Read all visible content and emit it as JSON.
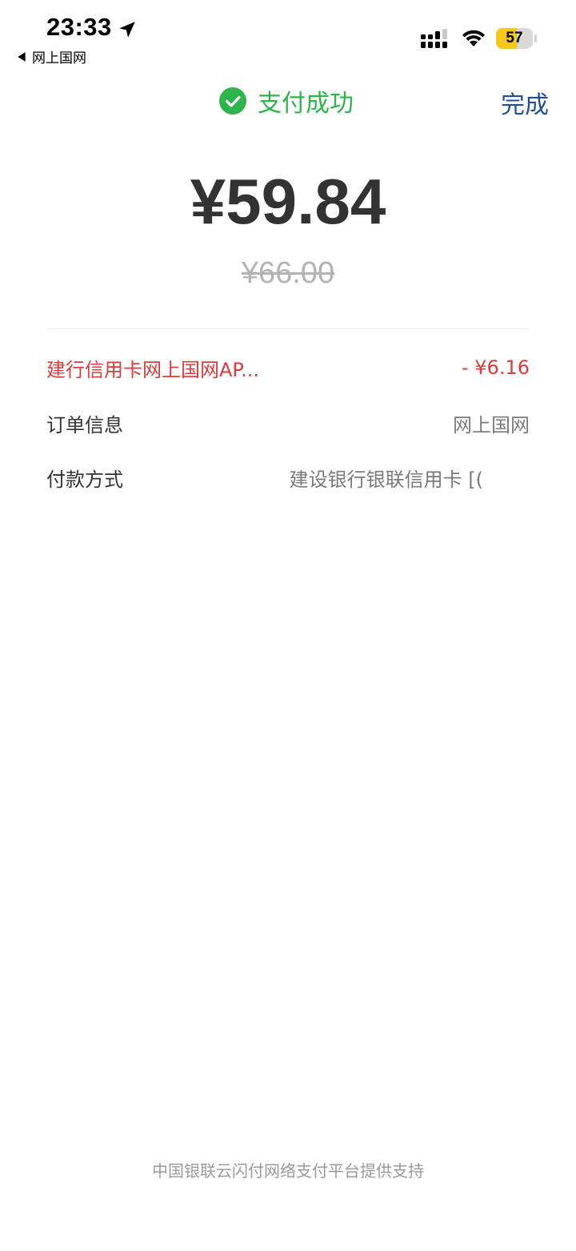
{
  "status_bar": {
    "time": "23:33",
    "back_app_label": "网上国网",
    "battery_level": "57",
    "battery_percent": 57,
    "icons": [
      "location-arrow-icon",
      "cellular-signal-icon",
      "wifi-icon",
      "battery-icon"
    ]
  },
  "header": {
    "status_text": "支付成功",
    "done_label": "完成"
  },
  "payment": {
    "amount": "¥59.84",
    "original_amount": "¥66.00"
  },
  "details": {
    "discount": {
      "label": "建行信用卡网上国网AP...",
      "value": "- ¥6.16"
    },
    "order_info": {
      "label": "订单信息",
      "value": "网上国网"
    },
    "payment_method": {
      "label": "付款方式",
      "value": "建设银行银联信用卡 [("
    }
  },
  "footer": {
    "text": "中国银联云闪付网络支付平台提供支持"
  },
  "colors": {
    "success": "#2db44a",
    "link": "#1f4f98",
    "discount": "#e03a3a",
    "battery": "#f3c81b"
  }
}
